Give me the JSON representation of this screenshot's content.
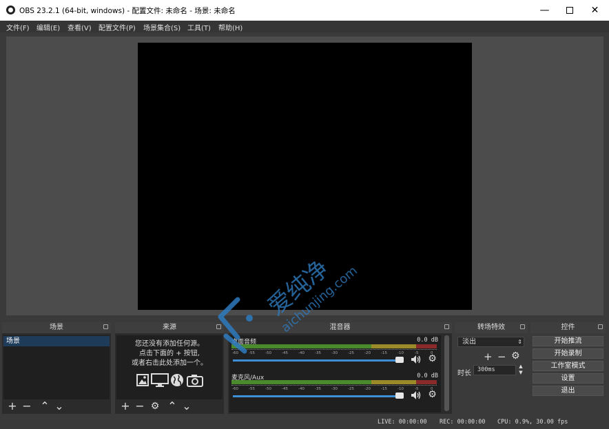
{
  "window": {
    "title": "OBS 23.2.1 (64-bit, windows) - 配置文件: 未命名 - 场景: 未命名",
    "minimize": "—",
    "close": "✕"
  },
  "menu": [
    "文件(F)",
    "编辑(E)",
    "查看(V)",
    "配置文件(P)",
    "场景集合(S)",
    "工具(T)",
    "帮助(H)"
  ],
  "docks": {
    "scenes": {
      "title": "场景",
      "items": [
        "场景"
      ]
    },
    "sources": {
      "title": "来源",
      "hint_line1": "您还没有添加任何源。",
      "hint_line2": "点击下面的 + 按钮,",
      "hint_line3": "或者右击此处添加一个。"
    },
    "mixer": {
      "title": "混音器",
      "scale": [
        "-60",
        "-55",
        "-50",
        "-45",
        "-40",
        "-35",
        "-30",
        "-25",
        "-20",
        "-15",
        "-10",
        "-5",
        "0"
      ],
      "tracks": [
        {
          "name": "桌面音频",
          "db": "0.0 dB",
          "level": 0.95
        },
        {
          "name": "麦克风/Aux",
          "db": "0.0 dB",
          "level": 0.95
        }
      ]
    },
    "transitions": {
      "title": "转场特效",
      "selected": "淡出",
      "duration_label": "时长",
      "duration_value": "300ms"
    },
    "controls": {
      "title": "控件",
      "buttons": [
        "开始推流",
        "开始录制",
        "工作室模式",
        "设置",
        "退出"
      ]
    }
  },
  "status": {
    "live": "LIVE: 00:00:00",
    "rec": "REC: 00:00:00",
    "cpu": "CPU: 0.9%, 30.00 fps"
  },
  "watermark": {
    "cn": "爱纯净",
    "url": "aichunjing.com"
  },
  "colors": {
    "accent": "#3d8fd6",
    "selection": "#1e3c5a",
    "canvas": "#000000"
  },
  "icons": [
    "obs-logo-icon",
    "plus-icon",
    "minus-icon",
    "up-icon",
    "down-icon",
    "gear-icon",
    "speaker-icon",
    "image-icon",
    "monitor-icon",
    "globe-icon",
    "camera-icon"
  ]
}
